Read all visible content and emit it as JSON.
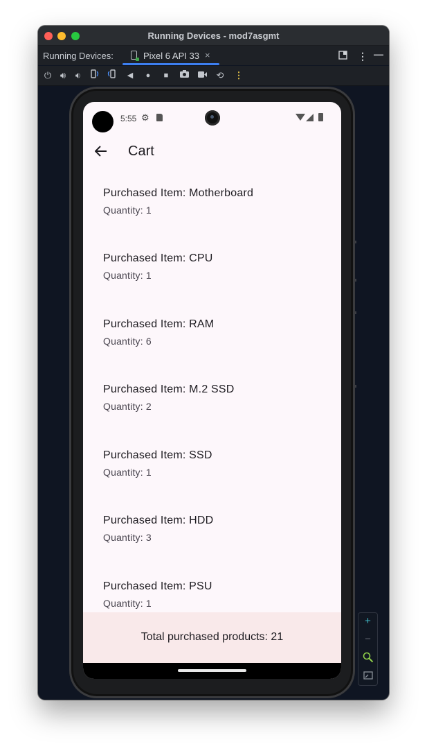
{
  "window": {
    "title": "Running Devices - mod7asgmt",
    "tabbar_label": "Running Devices:",
    "device_tab": "Pixel 6 API 33",
    "device_tab_close": "×",
    "colors": {
      "accent": "#3d7ff0",
      "background": "#0f1522",
      "toolbar": "#1e2126"
    }
  },
  "toolbar": {
    "icons": [
      "power-icon",
      "volume-up-icon",
      "volume-down-icon",
      "rotate-left-icon",
      "rotate-right-icon",
      "back-icon",
      "home-icon",
      "overview-icon",
      "camera-icon",
      "screen-record-icon",
      "reset-icon",
      "more-icon"
    ]
  },
  "phone": {
    "status": {
      "time": "5:55"
    },
    "appbar": {
      "title": "Cart",
      "back_icon": "arrow-back-icon"
    },
    "items": [
      {
        "title": "Purchased Item: Motherboard",
        "quantity": "Quantity: 1"
      },
      {
        "title": "Purchased Item: CPU",
        "quantity": "Quantity: 1"
      },
      {
        "title": "Purchased Item: RAM",
        "quantity": "Quantity: 6"
      },
      {
        "title": "Purchased Item: M.2 SSD",
        "quantity": "Quantity: 2"
      },
      {
        "title": "Purchased Item: SSD",
        "quantity": "Quantity: 1"
      },
      {
        "title": "Purchased Item: HDD",
        "quantity": "Quantity: 3"
      },
      {
        "title": "Purchased Item: PSU",
        "quantity": "Quantity: 1"
      }
    ],
    "footer": {
      "total": "Total purchased products: 21"
    },
    "colors": {
      "screen_bg": "#fdf7fb",
      "footer_bg": "#f9e9ea"
    }
  },
  "zoom": {
    "zoom_in": "+",
    "zoom_out": "−",
    "actual_size_icon": "zoom-actual-icon",
    "fit_screen_icon": "fit-screen-icon"
  }
}
